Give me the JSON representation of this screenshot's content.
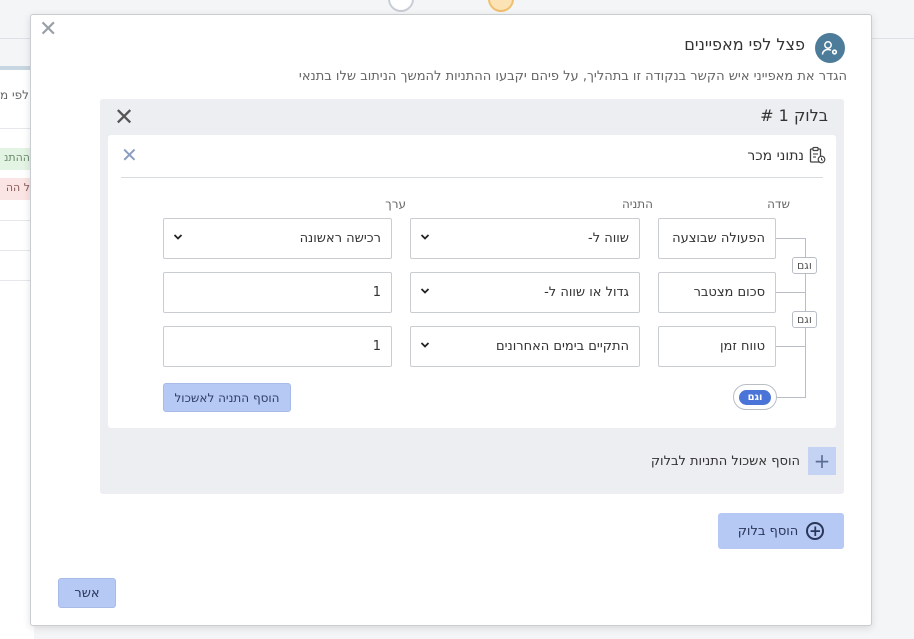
{
  "background": {
    "left_text": "לפי מ",
    "chip_green": "ההתנ",
    "chip_red": "ל הה"
  },
  "modal": {
    "title": "פצל לפי מאפיינים",
    "description": "הגדר את מאפייני איש הקשר בנקודה זו בתהליך, על פיהם יקבעו ההתניות להמשך הניתוב שלו בתנאי",
    "close_icon": "close-icon",
    "header_icon": "user-settings-icon"
  },
  "block": {
    "title": "בלוק 1 #",
    "group": {
      "title": "נתוני מכר",
      "icon": "clipboard-clock-icon",
      "columns": {
        "field": "שדה",
        "condition": "התניה",
        "value": "ערך"
      },
      "rows": [
        {
          "field": "הפעולה שבוצעה",
          "condition": "שווה ל-",
          "value": "רכישה ראשונה"
        },
        {
          "field": "סכום מצטבר",
          "condition": "גדול או שווה ל-",
          "value": "1"
        },
        {
          "field": "טווח זמן",
          "condition": "התקיים בימים האחרונים",
          "value": "1"
        }
      ],
      "and_label": "וגם",
      "and_toggle_label": "וגם",
      "add_condition_label": "הוסף התניה לאשכול"
    },
    "add_group_label": "הוסף אשכול התניות לבלוק"
  },
  "footer": {
    "add_block_label": "הוסף בלוק",
    "confirm_label": "אשר"
  },
  "colors": {
    "accent": "#4a74d8",
    "button_bg": "#b6c8f4",
    "icon_bg": "#4d7c9a"
  }
}
